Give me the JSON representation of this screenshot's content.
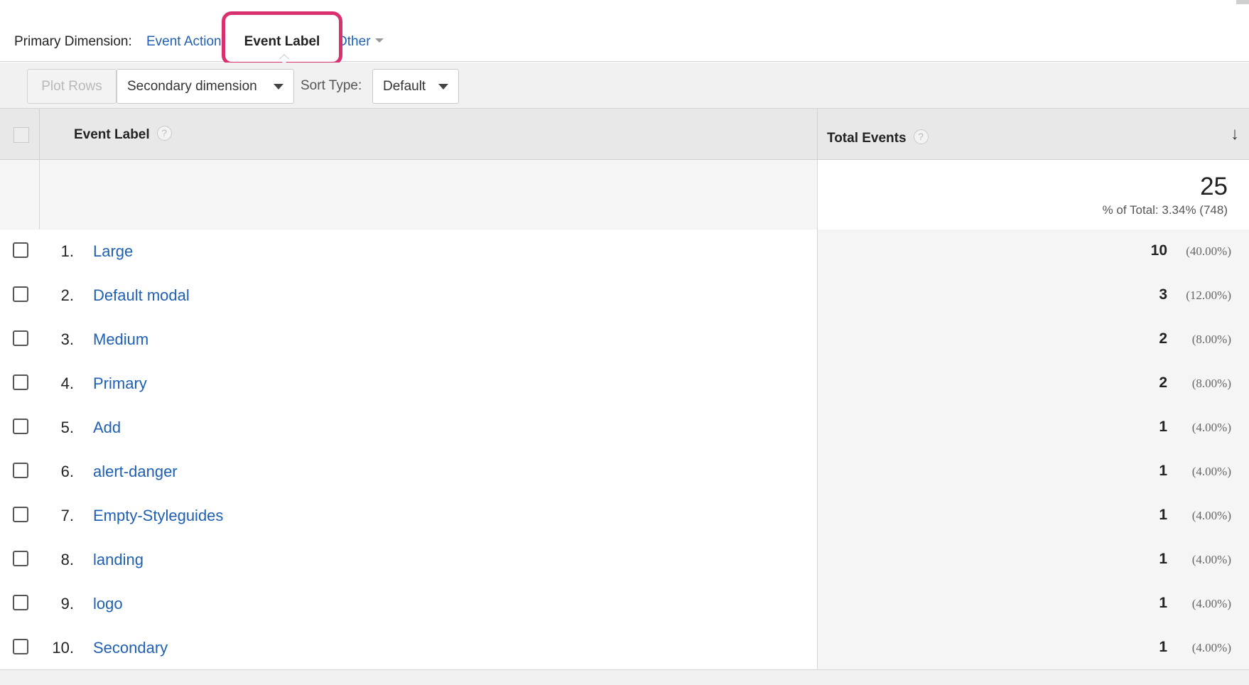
{
  "dimension_bar": {
    "label": "Primary Dimension:",
    "options": [
      {
        "label": "Event Action"
      },
      {
        "label": "Event Label"
      },
      {
        "label": "Other"
      }
    ]
  },
  "toolbar": {
    "plot_rows": "Plot Rows",
    "secondary_dimension": "Secondary dimension",
    "sort_type_label": "Sort Type:",
    "sort_type_value": "Default"
  },
  "table": {
    "columns": {
      "label": "Event Label",
      "total": "Total Events",
      "help": "?"
    },
    "summary": {
      "total": "25",
      "pct_of_total": "% of Total: 3.34% (748)"
    },
    "rows": [
      {
        "rank": "1.",
        "label": "Large",
        "value": "10",
        "pct": "(40.00%)"
      },
      {
        "rank": "2.",
        "label": "Default modal",
        "value": "3",
        "pct": "(12.00%)"
      },
      {
        "rank": "3.",
        "label": "Medium",
        "value": "2",
        "pct": "(8.00%)"
      },
      {
        "rank": "4.",
        "label": "Primary",
        "value": "2",
        "pct": "(8.00%)"
      },
      {
        "rank": "5.",
        "label": "Add",
        "value": "1",
        "pct": "(4.00%)"
      },
      {
        "rank": "6.",
        "label": "alert-danger",
        "value": "1",
        "pct": "(4.00%)"
      },
      {
        "rank": "7.",
        "label": "Empty-Styleguides",
        "value": "1",
        "pct": "(4.00%)"
      },
      {
        "rank": "8.",
        "label": "landing",
        "value": "1",
        "pct": "(4.00%)"
      },
      {
        "rank": "9.",
        "label": "logo",
        "value": "1",
        "pct": "(4.00%)"
      },
      {
        "rank": "10.",
        "label": "Secondary",
        "value": "1",
        "pct": "(4.00%)"
      }
    ]
  },
  "colors": {
    "link": "#1f5fb4",
    "highlight": "#d9306f"
  }
}
